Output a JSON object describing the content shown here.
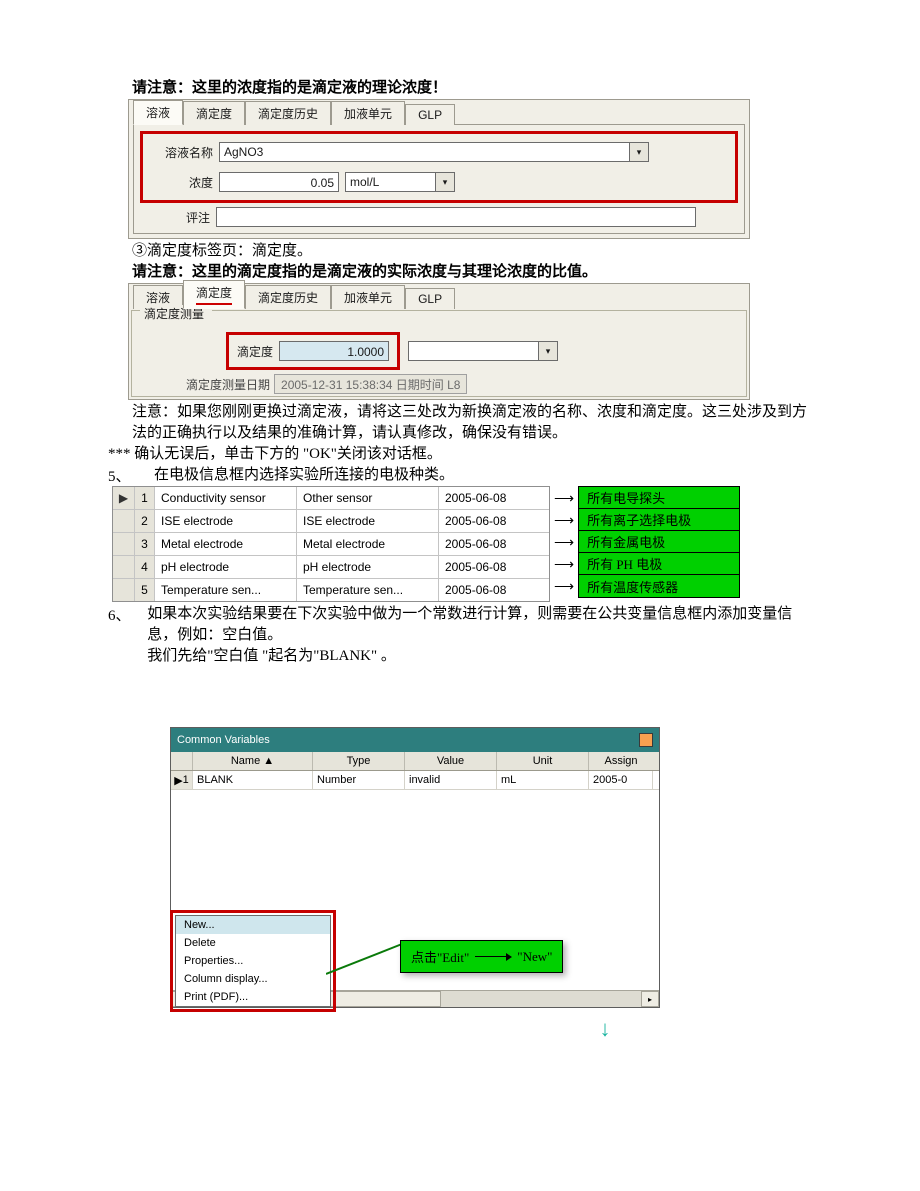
{
  "intro1": "请注意：这里的浓度指的是滴定液的理论浓度！",
  "shot1": {
    "tabs": [
      "溶液",
      "滴定度",
      "滴定度历史",
      "加液单元",
      "GLP"
    ],
    "active_tab": "溶液",
    "fields": {
      "name_label": "溶液名称",
      "name_val": "AgNO3",
      "conc_label": "浓度",
      "conc_val": "0.05",
      "conc_unit": "mol/L",
      "comment_label": "评注",
      "comment_val": ""
    }
  },
  "mid1": "③滴定度标签页：滴定度。",
  "mid2": "请注意：这里的滴定度指的是滴定液的实际浓度与其理论浓度的比值。",
  "shot2": {
    "tabs": [
      "溶液",
      "滴定度",
      "滴定度历史",
      "加液单元",
      "GLP"
    ],
    "active_tab": "滴定度",
    "legend": "滴定度测量",
    "titer_label": "滴定度",
    "titer_val": "1.0000",
    "date_label": "滴定度测量日期",
    "date_val": "2005-12-31 15:38:34 日期时间 L8"
  },
  "after2a": "注意：如果您刚刚更换过滴定液，请将这三处改为新换滴定液的名称、浓度和滴定度。这三处涉及到方法的正确执行以及结果的准确计算，请认真修改，确保没有错误。",
  "after2b": "*** 确认无误后，单击下方的 \"OK\"关闭该对话框。",
  "step5": "5、",
  "step5txt": "在电极信息框内选择实验所连接的电极种类。",
  "etable": {
    "rows": [
      {
        "n": "1",
        "c1": "Conductivity sensor",
        "c2": "Other sensor",
        "c3": "2005-06-08",
        "g": "所有电导探头"
      },
      {
        "n": "2",
        "c1": "ISE electrode",
        "c2": "ISE electrode",
        "c3": "2005-06-08",
        "g": "所有离子选择电极"
      },
      {
        "n": "3",
        "c1": "Metal electrode",
        "c2": "Metal electrode",
        "c3": "2005-06-08",
        "g": "所有金属电极"
      },
      {
        "n": "4",
        "c1": "pH electrode",
        "c2": "pH electrode",
        "c3": "2005-06-08",
        "g": "所有 PH 电极"
      },
      {
        "n": "5",
        "c1": "Temperature sen...",
        "c2": "Temperature sen...",
        "c3": "2005-06-08",
        "g": "所有温度传感器"
      }
    ]
  },
  "step6": "6、",
  "step6a": "如果本次实验结果要在下次实验中做为一个常数进行计算，则需要在公共变量信息框内添加变量信息，例如：空白值。",
  "step6b": "我们先给\"空白值 \"起名为\"BLANK\" 。",
  "cv": {
    "title": "Common Variables",
    "cols": [
      "",
      "Name ▲",
      "Type",
      "Value",
      "Unit",
      "Assign"
    ],
    "row": {
      "idx": "1",
      "name": "BLANK",
      "type": "Number",
      "value": "invalid",
      "unit": "mL",
      "assign": "2005-0"
    },
    "menu": [
      "New...",
      "Delete",
      "Properties...",
      "Column display...",
      "Print (PDF)..."
    ],
    "callout_a": "点击\"Edit\"",
    "callout_b": "\"New\""
  }
}
